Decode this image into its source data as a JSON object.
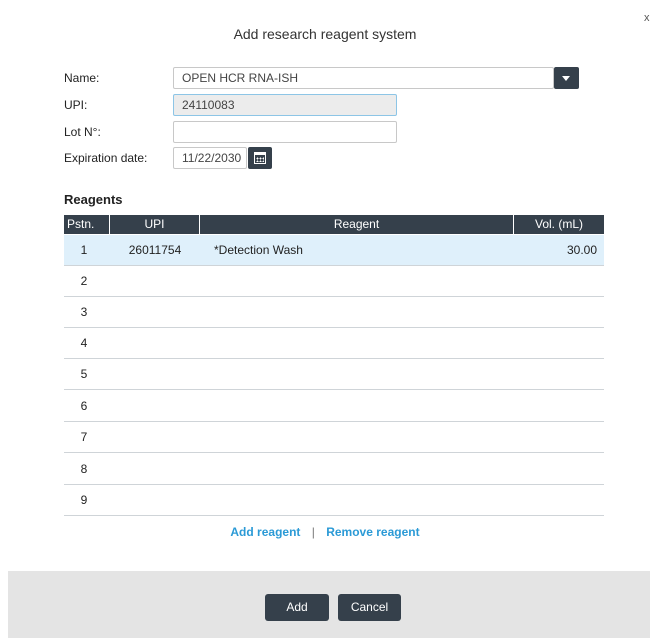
{
  "dialog": {
    "title": "Add research reagent system",
    "close_glyph": "x"
  },
  "form": {
    "name_label": "Name:",
    "name_value": "OPEN HCR RNA-ISH",
    "upi_label": "UPI:",
    "upi_value": "24110083",
    "lot_label": "Lot N°:",
    "lot_value": "",
    "expiration_label": "Expiration date:",
    "expiration_value": "11/22/2030"
  },
  "reagents": {
    "title": "Reagents",
    "columns": [
      "Pstn.",
      "UPI",
      "Reagent",
      "Vol. (mL)"
    ],
    "rows": [
      {
        "pstn": "1",
        "upi": "26011754",
        "reagent": "*Detection Wash",
        "vol": "30.00"
      },
      {
        "pstn": "2",
        "upi": "",
        "reagent": "",
        "vol": ""
      },
      {
        "pstn": "3",
        "upi": "",
        "reagent": "",
        "vol": ""
      },
      {
        "pstn": "4",
        "upi": "",
        "reagent": "",
        "vol": ""
      },
      {
        "pstn": "5",
        "upi": "",
        "reagent": "",
        "vol": ""
      },
      {
        "pstn": "6",
        "upi": "",
        "reagent": "",
        "vol": ""
      },
      {
        "pstn": "7",
        "upi": "",
        "reagent": "",
        "vol": ""
      },
      {
        "pstn": "8",
        "upi": "",
        "reagent": "",
        "vol": ""
      },
      {
        "pstn": "9",
        "upi": "",
        "reagent": "",
        "vol": ""
      }
    ],
    "add_link": "Add reagent",
    "separator": "|",
    "remove_link": "Remove reagent"
  },
  "footer": {
    "add_label": "Add",
    "cancel_label": "Cancel"
  },
  "colors": {
    "header_dark": "#35404b",
    "selected_row": "#dff0fb",
    "link": "#2b9ad6",
    "footer_bg": "#e4e4e4"
  },
  "icons": [
    "chevron-down-icon",
    "calendar-icon"
  ]
}
